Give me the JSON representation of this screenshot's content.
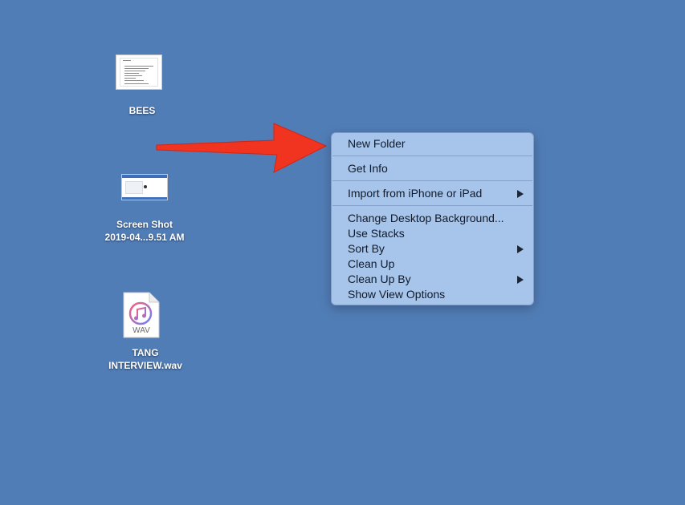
{
  "desktop": {
    "background_color": "#517db7",
    "icons": [
      {
        "label_lines": [
          "BEES"
        ],
        "icon": "document-thumbnail-icon"
      },
      {
        "label_lines": [
          "Screen Shot",
          "2019-04...9.51 AM"
        ],
        "icon": "screenshot-thumbnail-icon"
      },
      {
        "label_lines": [
          "TANG",
          "INTERVIEW.wav"
        ],
        "icon": "wav-file-icon",
        "badge": "WAV"
      }
    ]
  },
  "context_menu": {
    "items": [
      {
        "label": "New Folder",
        "has_submenu": false
      },
      {
        "label": "Get Info",
        "has_submenu": false
      },
      {
        "label": "Import from iPhone or iPad",
        "has_submenu": true
      },
      {
        "label": "Change Desktop Background...",
        "has_submenu": false
      },
      {
        "label": "Use Stacks",
        "has_submenu": false
      },
      {
        "label": "Sort By",
        "has_submenu": true
      },
      {
        "label": "Clean Up",
        "has_submenu": false
      },
      {
        "label": "Clean Up By",
        "has_submenu": true
      },
      {
        "label": "Show View Options",
        "has_submenu": false
      }
    ]
  },
  "annotation": {
    "arrow_color": "#f0341f",
    "icon": "red-arrow-icon"
  }
}
